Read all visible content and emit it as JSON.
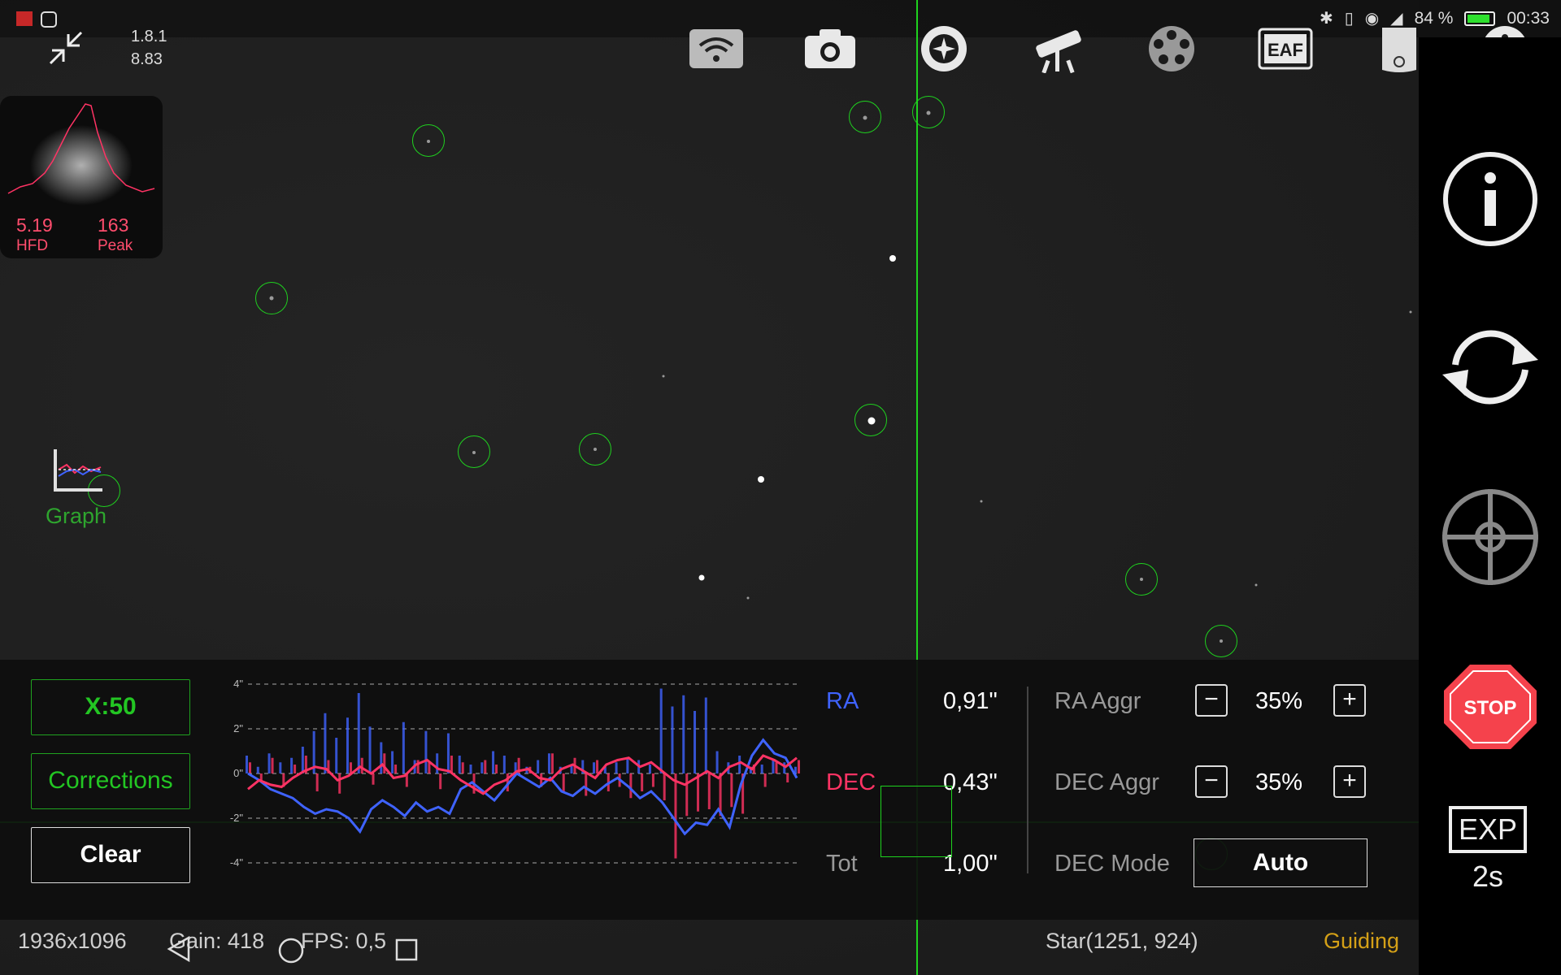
{
  "status_bar": {
    "battery": "84 %",
    "time": "00:33"
  },
  "header": {
    "version": "1.8.1",
    "sub_version": "8.83"
  },
  "star_profile": {
    "hfd_value": "5.19",
    "hfd_label": "HFD",
    "peak_value": "163",
    "peak_label": "Peak"
  },
  "graph_toggle": {
    "label": "Graph"
  },
  "toolbar": {
    "icons": [
      "wifi-icon",
      "camera-icon",
      "guide-target-icon",
      "telescope-icon",
      "filter-wheel-icon",
      "eaf-icon",
      "flip-icon",
      "info-icon"
    ],
    "eaf_label": "EAF"
  },
  "right_rail": {
    "icons": [
      "info-icon",
      "refresh-icon",
      "crosshair-icon",
      "stop-icon"
    ],
    "stop_label": "STOP",
    "exp_label": "EXP",
    "exp_value": "2s"
  },
  "left_buttons": {
    "x_scale": "X:50",
    "corrections": "Corrections",
    "clear": "Clear"
  },
  "stats": {
    "ra_label": "RA",
    "ra_value": "0,91\"",
    "dec_label": "DEC",
    "dec_value": "0,43\"",
    "tot_label": "Tot",
    "tot_value": "1,00\""
  },
  "settings": {
    "ra_aggr_label": "RA Aggr",
    "ra_aggr_value": "35%",
    "dec_aggr_label": "DEC Aggr",
    "dec_aggr_value": "35%",
    "dec_mode_label": "DEC Mode",
    "dec_mode_value": "Auto"
  },
  "footer": {
    "resolution": "1936x1096",
    "gain": "Gain: 418",
    "fps": "FPS: 0,5",
    "star_pos": "Star(1251, 924)",
    "state": "Guiding"
  },
  "colors": {
    "ra": "#3f63ff",
    "dec": "#ff3364",
    "accent": "#1ed21e",
    "guiding": "#d4a017"
  },
  "chart_data": {
    "type": "line",
    "y_tick_labels": [
      "4\"",
      "2\"",
      "0\"",
      "-2\"",
      "-4\""
    ],
    "ylim": [
      -4,
      4
    ],
    "x": [
      0,
      1,
      2,
      3,
      4,
      5,
      6,
      7,
      8,
      9,
      10,
      11,
      12,
      13,
      14,
      15,
      16,
      17,
      18,
      19,
      20,
      21,
      22,
      23,
      24,
      25,
      26,
      27,
      28,
      29,
      30,
      31,
      32,
      33,
      34,
      35,
      36,
      37,
      38,
      39,
      40,
      41,
      42,
      43,
      44,
      45,
      46,
      47,
      48,
      49
    ],
    "series": [
      {
        "name": "RA",
        "values": [
          0.0,
          -0.3,
          -0.7,
          -0.9,
          -1.1,
          -1.5,
          -1.8,
          -1.6,
          -1.7,
          -2.0,
          -2.6,
          -1.6,
          -1.2,
          -1.5,
          -1.9,
          -1.3,
          -1.7,
          -1.5,
          -1.8,
          -0.7,
          -0.4,
          -0.8,
          -1.2,
          -0.6,
          0.0,
          -0.3,
          -0.6,
          -0.2,
          -0.8,
          -1.0,
          -0.6,
          -0.9,
          -0.5,
          -0.2,
          -0.6,
          -1.1,
          -0.8,
          -1.3,
          -2.0,
          -2.7,
          -2.2,
          -2.3,
          -1.6,
          -2.4,
          -0.5,
          0.8,
          1.5,
          0.9,
          0.7,
          -0.2
        ],
        "color": "#3f63ff"
      },
      {
        "name": "DEC",
        "values": [
          -0.7,
          -0.3,
          -0.5,
          -0.6,
          -0.2,
          0.1,
          0.3,
          0.2,
          -0.3,
          -0.1,
          0.3,
          0.0,
          0.4,
          -0.2,
          -0.1,
          0.4,
          0.6,
          0.2,
          0.1,
          -0.3,
          -0.6,
          -0.9,
          -0.5,
          -0.3,
          0.1,
          0.2,
          -0.2,
          -0.3,
          0.2,
          0.4,
          0.1,
          -0.2,
          0.4,
          0.6,
          0.7,
          0.3,
          0.5,
          0.1,
          -0.3,
          -0.5,
          -0.2,
          0.1,
          -0.2,
          0.3,
          0.5,
          0.2,
          0.8,
          0.6,
          0.3,
          0.7
        ],
        "color": "#ff3364"
      }
    ],
    "corrections_ra": [
      0.8,
      0.3,
      0.9,
      0.5,
      0.7,
      1.2,
      1.9,
      2.7,
      1.6,
      2.5,
      3.6,
      2.1,
      1.4,
      1.0,
      2.3,
      0.6,
      1.9,
      0.9,
      1.8,
      0.8,
      0.4,
      0.5,
      1.0,
      0.8,
      0.5,
      0.3,
      0.6,
      0.9,
      0.3,
      0.4,
      0.6,
      0.5,
      0.3,
      0.5,
      0.7,
      0.6,
      0.4,
      3.8,
      3.0,
      3.5,
      2.8,
      3.4,
      1.0,
      0.5,
      0.8,
      0.3,
      0.4,
      0.6,
      0.5,
      0.3
    ],
    "corrections_dec": [
      0.5,
      -0.3,
      0.7,
      -0.6,
      0.4,
      0.8,
      -0.8,
      0.6,
      -0.9,
      0.5,
      0.7,
      -0.5,
      0.9,
      0.4,
      -0.6,
      0.6,
      0.5,
      -0.7,
      0.8,
      0.5,
      -0.9,
      0.6,
      0.4,
      -0.8,
      0.7,
      0.3,
      -0.6,
      0.9,
      -0.8,
      0.7,
      -1.0,
      0.6,
      -0.8,
      -0.6,
      -1.1,
      -0.8,
      -0.6,
      -1.2,
      -3.8,
      -1.9,
      -1.7,
      -1.6,
      -1.9,
      -1.5,
      -1.8,
      0.4,
      -0.6,
      0.5,
      -0.4,
      0.6
    ]
  }
}
